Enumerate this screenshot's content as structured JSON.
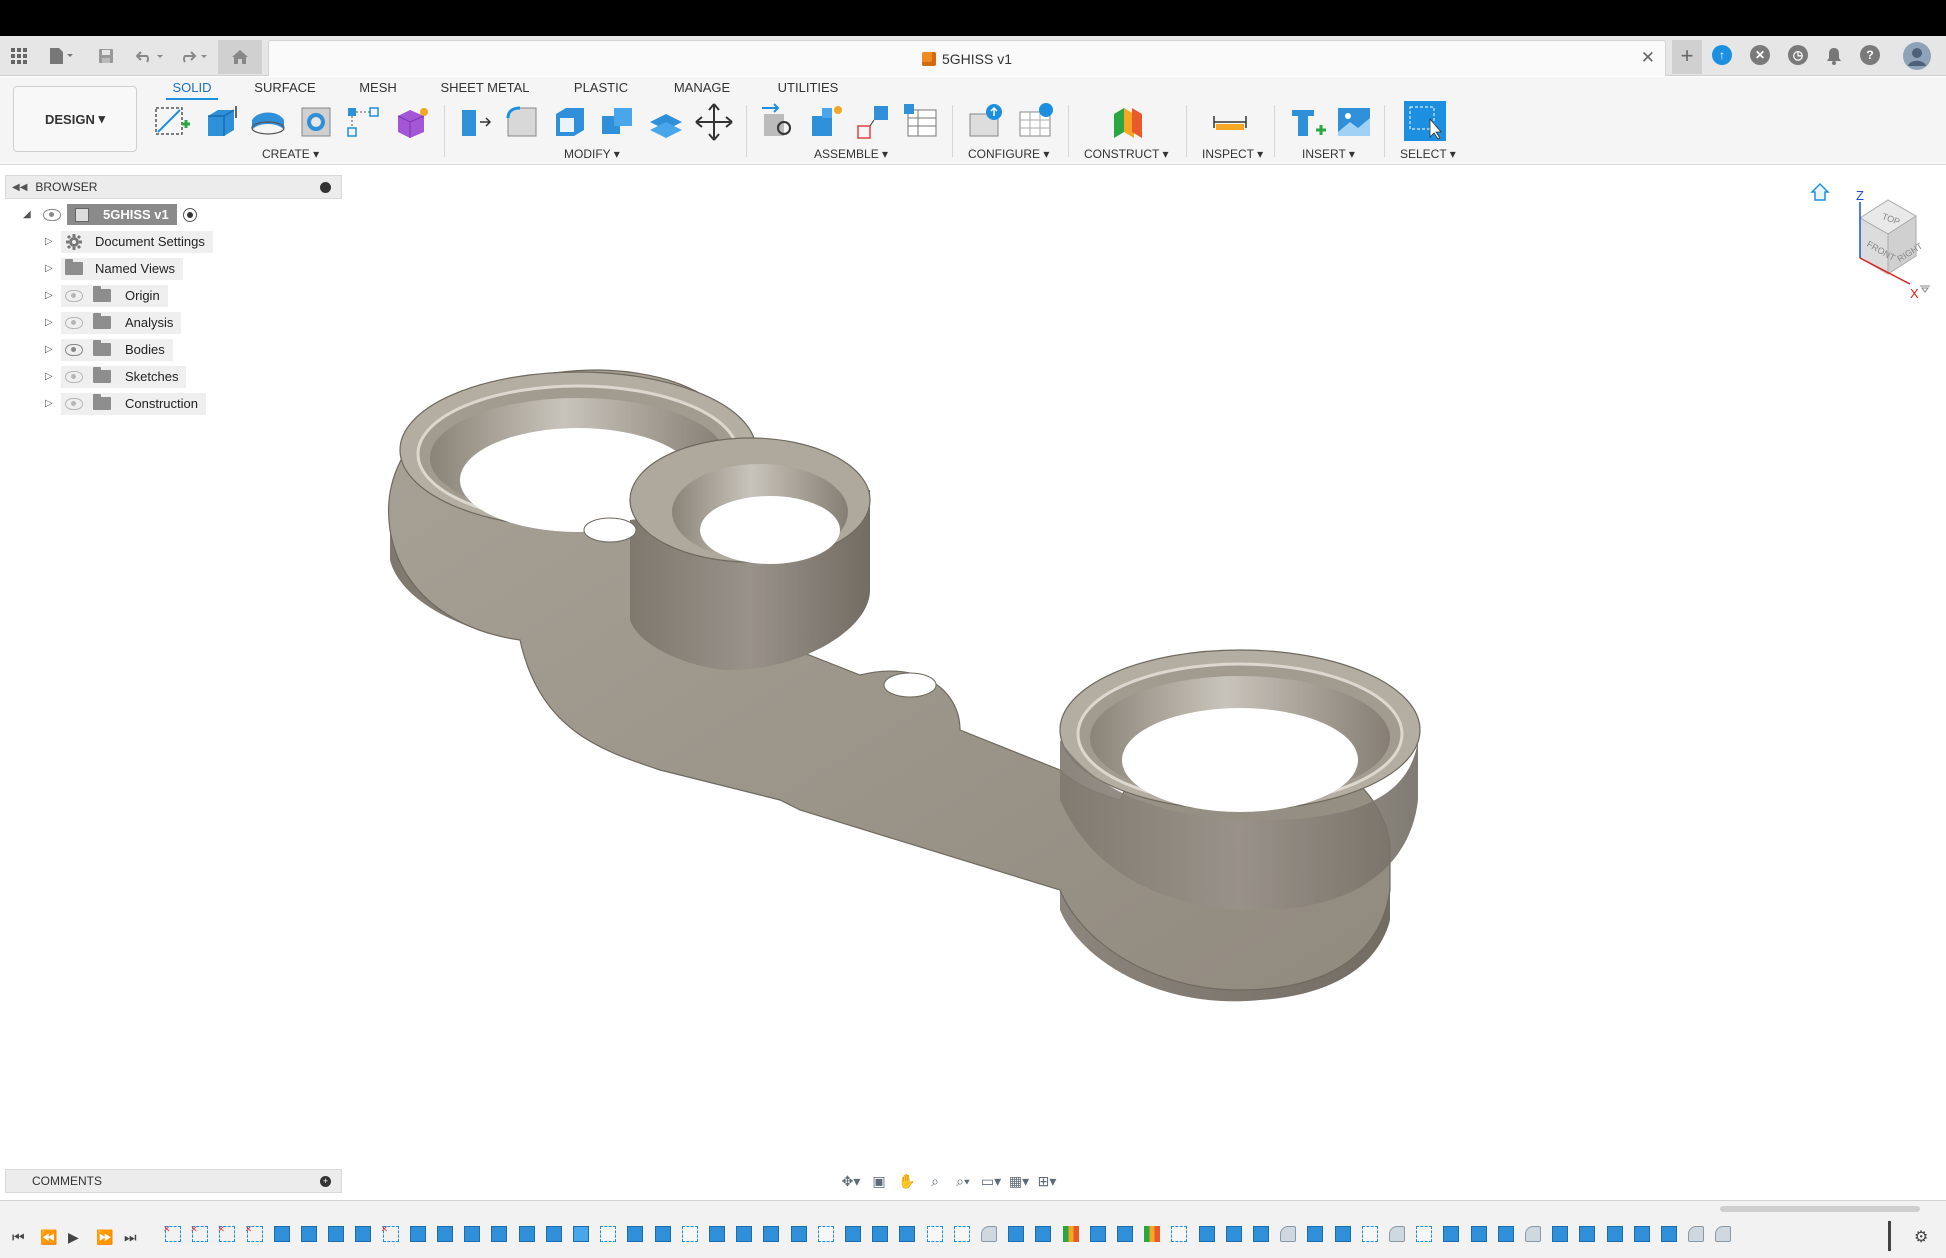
{
  "document": {
    "title": "5GHISS v1"
  },
  "workspace": {
    "label": "DESIGN"
  },
  "tabs": [
    "SOLID",
    "SURFACE",
    "MESH",
    "SHEET METAL",
    "PLASTIC",
    "MANAGE",
    "UTILITIES"
  ],
  "groups": {
    "create": "CREATE",
    "modify": "MODIFY",
    "assemble": "ASSEMBLE",
    "configure": "CONFIGURE",
    "construct": "CONSTRUCT",
    "inspect": "INSPECT",
    "insert": "INSERT",
    "select": "SELECT"
  },
  "browser": {
    "title": "BROWSER",
    "root": "5GHISS v1",
    "items": [
      {
        "label": "Document Settings",
        "icon": "gear-icon"
      },
      {
        "label": "Named Views",
        "icon": "folder-icon"
      },
      {
        "label": "Origin",
        "icon": "folder-icon",
        "visible": false
      },
      {
        "label": "Analysis",
        "icon": "folder-icon",
        "visible": false
      },
      {
        "label": "Bodies",
        "icon": "folder-icon",
        "visible": true
      },
      {
        "label": "Sketches",
        "icon": "folder-icon",
        "visible": false
      },
      {
        "label": "Construction",
        "icon": "folder-icon",
        "visible": false
      }
    ]
  },
  "comments": {
    "title": "COMMENTS"
  },
  "viewcube": {
    "top": "TOP",
    "front": "FRONT",
    "right": "RIGHT",
    "axis_z": "Z",
    "axis_x": "X"
  },
  "colors": {
    "accent": "#1d8fe0",
    "model": "#8f887d",
    "model_light": "#b8b2a7",
    "model_dark": "#6d675e"
  }
}
